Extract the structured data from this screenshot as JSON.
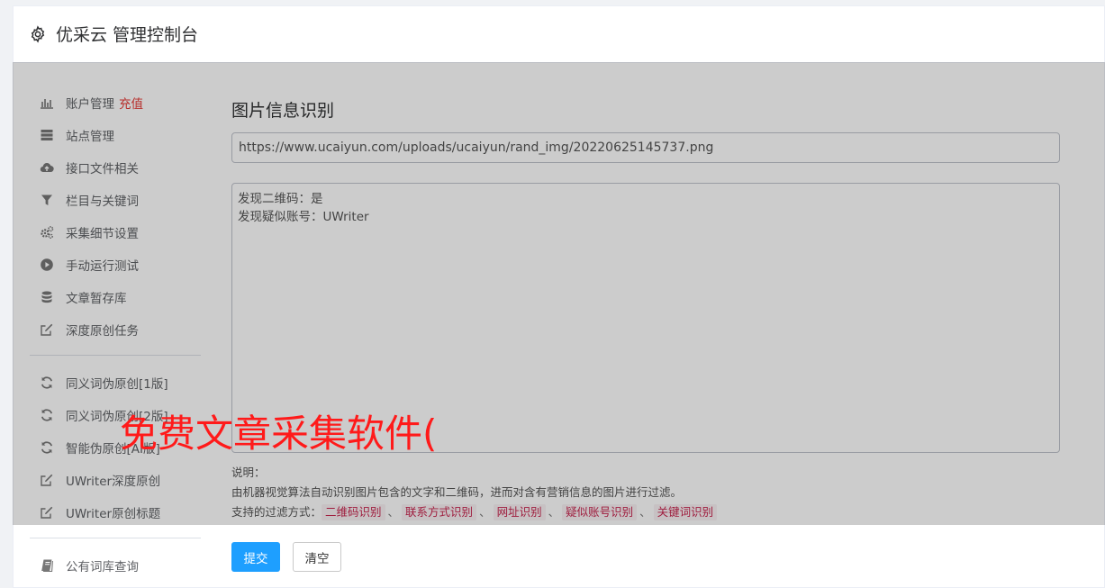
{
  "header": {
    "title": "优采云 管理控制台",
    "icon": "gear-icon"
  },
  "sidebar": {
    "groups": [
      [
        {
          "label": "账户管理",
          "badge": "充值",
          "icon": "bar-chart-icon"
        },
        {
          "label": "站点管理",
          "icon": "server-icon"
        },
        {
          "label": "接口文件相关",
          "icon": "cloud-upload-icon"
        },
        {
          "label": "栏目与关键词",
          "icon": "filter-icon"
        },
        {
          "label": "采集细节设置",
          "icon": "cogs-icon"
        },
        {
          "label": "手动运行测试",
          "icon": "play-circle-icon"
        },
        {
          "label": "文章暂存库",
          "icon": "database-icon"
        },
        {
          "label": "深度原创任务",
          "icon": "edit-icon"
        }
      ],
      [
        {
          "label": "同义词伪原创[1版]",
          "icon": "refresh-icon"
        },
        {
          "label": "同义词伪原创[2版]",
          "icon": "refresh-icon"
        },
        {
          "label": "智能伪原创[AI版]",
          "icon": "refresh-icon"
        },
        {
          "label": "UWriter深度原创",
          "icon": "edit-icon"
        },
        {
          "label": "UWriter原创标题",
          "icon": "edit-icon"
        }
      ],
      [
        {
          "label": "公有词库查询",
          "icon": "book-icon"
        }
      ]
    ],
    "badge_color": "#e53935"
  },
  "main": {
    "title": "图片信息识别",
    "url_value": "https://www.ucaiyun.com/uploads/ucaiyun/rand_img/20220625145737.png",
    "result_lines": [
      "发现二维码：是",
      "发现疑似账号：UWriter"
    ],
    "desc_label": "说明：",
    "desc_text": "由机器视觉算法自动识别图片包含的文字和二维码，进而对含有营销信息的图片进行过滤。",
    "filter_label": "支持的过滤方式：",
    "filter_tags": [
      "二维码识别",
      "联系方式识别",
      "网址识别",
      "疑似账号识别",
      "关键词识别"
    ],
    "tag_separator": "、",
    "submit_label": "提交",
    "clear_label": "清空",
    "accent_color": "#1e9fff"
  },
  "watermark": {
    "text": "免费文章采集软件(",
    "color": "#ff1a1a"
  }
}
